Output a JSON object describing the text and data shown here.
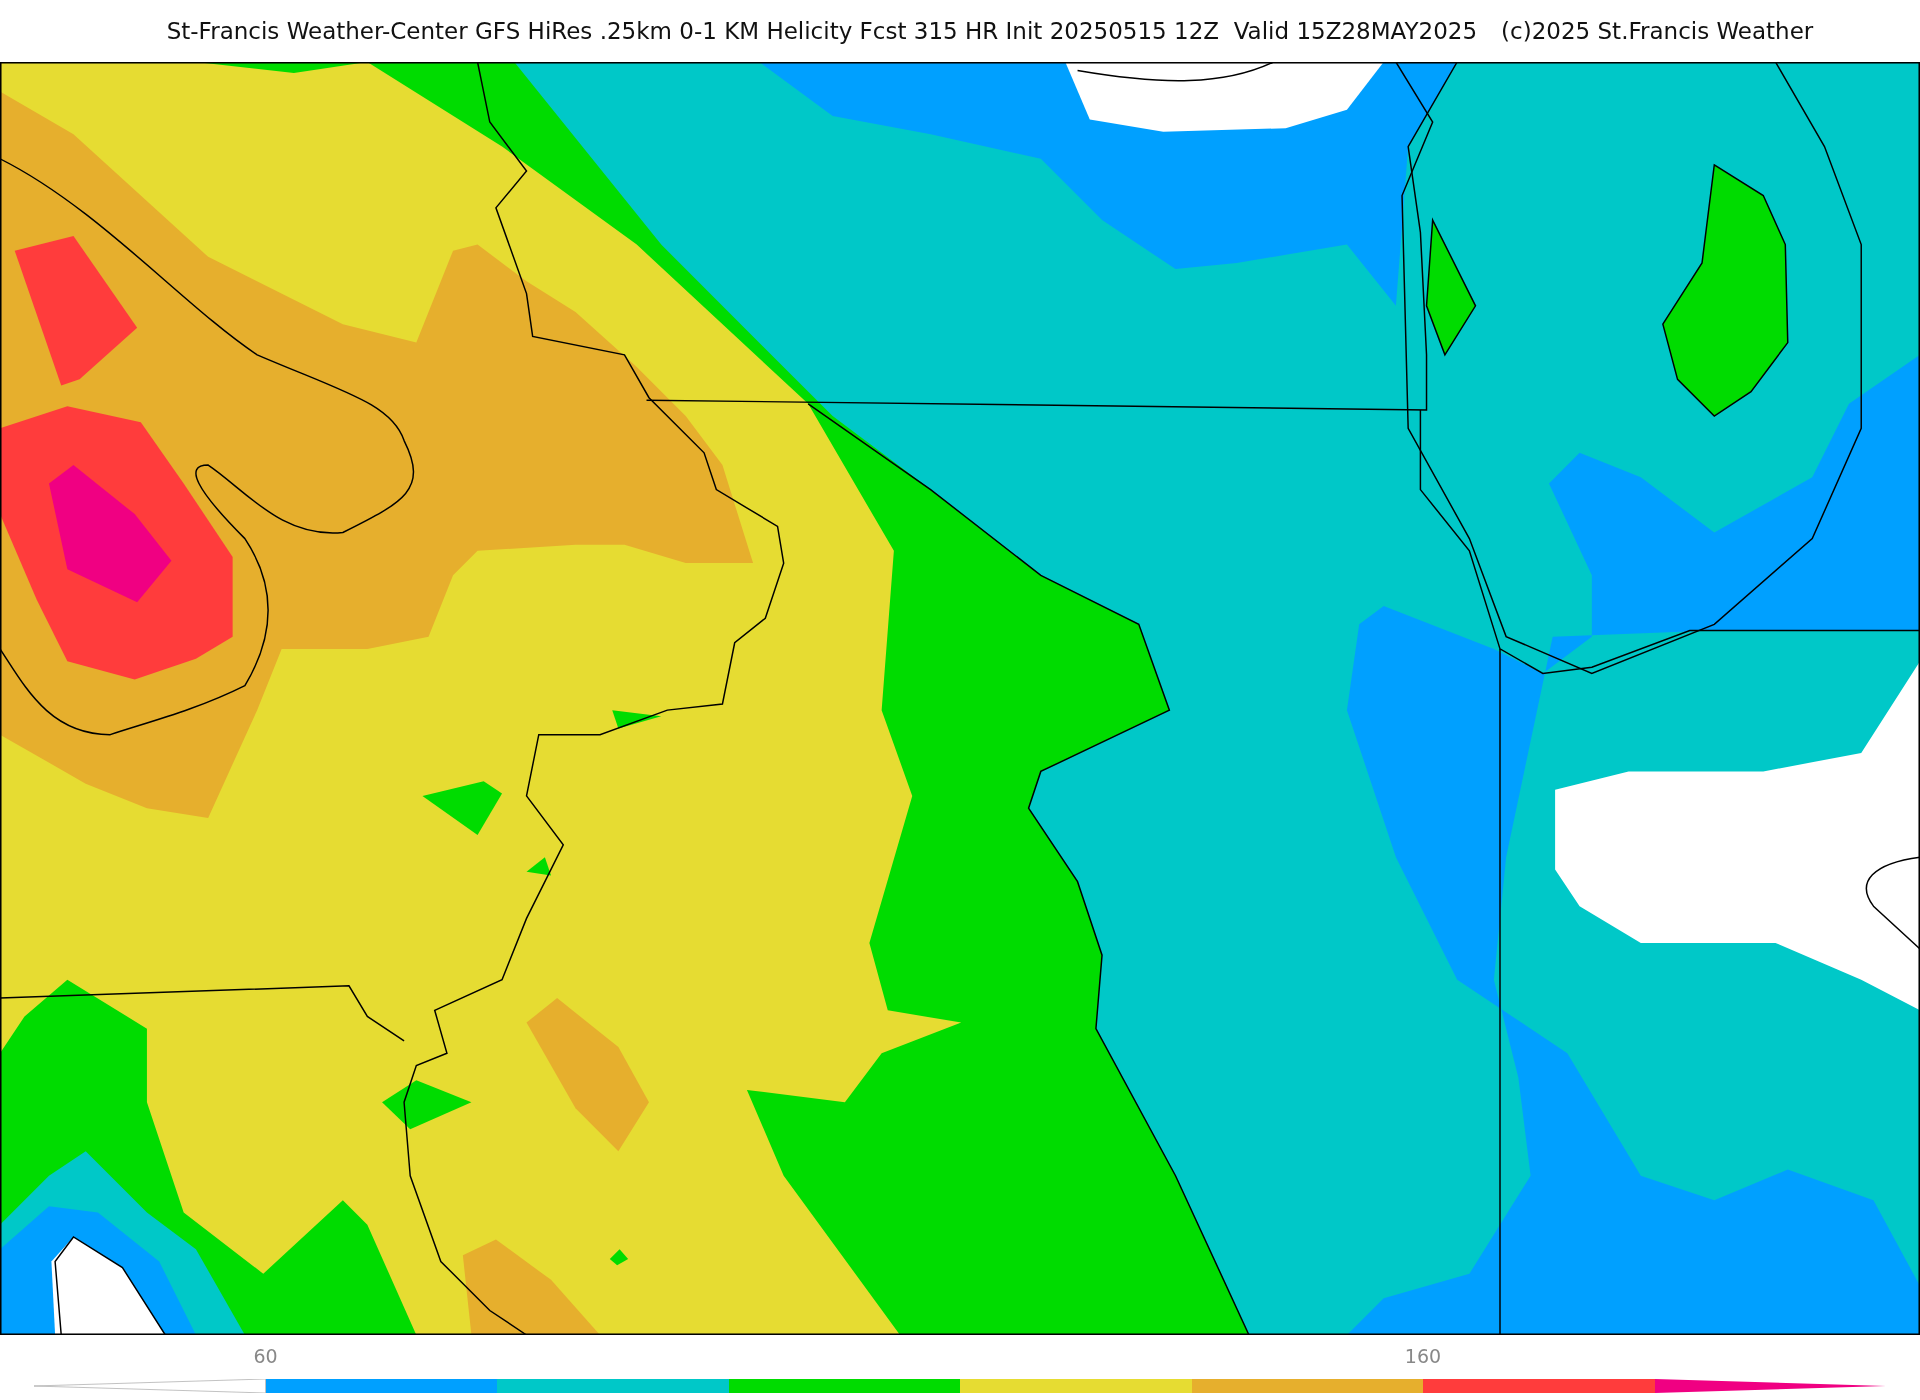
{
  "header": {
    "title": "St-Francis Weather-Center GFS HiRes .25km 0-1 KM Helicity Fcst 315 HR Init 20250515 12Z  Valid 15Z28MAY2025",
    "copyright": "(c)2025 St.Francis Weather"
  },
  "colorbar": {
    "segments": [
      {
        "kind": "left-arrow",
        "color": "#ffffff"
      },
      {
        "kind": "box",
        "color": "#00a0ff",
        "tick": "60"
      },
      {
        "kind": "box",
        "color": "#00c8c8"
      },
      {
        "kind": "box",
        "color": "#00dc00"
      },
      {
        "kind": "box",
        "color": "#e6dc32"
      },
      {
        "kind": "box",
        "color": "#e6af2d"
      },
      {
        "kind": "box",
        "color": "#ff3c3c",
        "tick": "160"
      },
      {
        "kind": "right-arrow",
        "color": "#f00082"
      }
    ]
  }
}
